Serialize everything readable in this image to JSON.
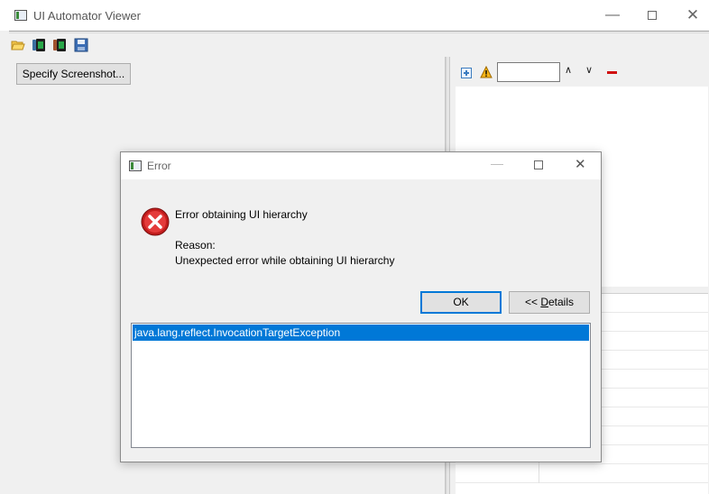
{
  "window": {
    "title": "UI Automator Viewer",
    "controls": [
      "minimize",
      "maximize",
      "close"
    ]
  },
  "toolbar": {
    "icons": [
      "open-folder-icon",
      "device-screenshot-icon",
      "device-screenshot-compressed-icon",
      "save-icon"
    ]
  },
  "left_pane": {
    "specify_button": "Specify Screenshot..."
  },
  "right_pane": {
    "toolbar_icons": [
      "expand-all-icon",
      "warning-icon",
      "previous-icon",
      "next-icon",
      "clear-icon"
    ],
    "search_value": ""
  },
  "dialog": {
    "title": "Error",
    "message": "Error obtaining UI hierarchy",
    "reason_label": "Reason:",
    "reason_text": "Unexpected error while obtaining UI hierarchy",
    "ok_label": "OK",
    "details_prefix": "<< ",
    "details_underlined": "D",
    "details_rest": "etails",
    "details_items": [
      "java.lang.reflect.InvocationTargetException"
    ]
  },
  "colors": {
    "selection": "#0078d7",
    "error_red": "#d21f1f",
    "accent": "#0078d7"
  }
}
